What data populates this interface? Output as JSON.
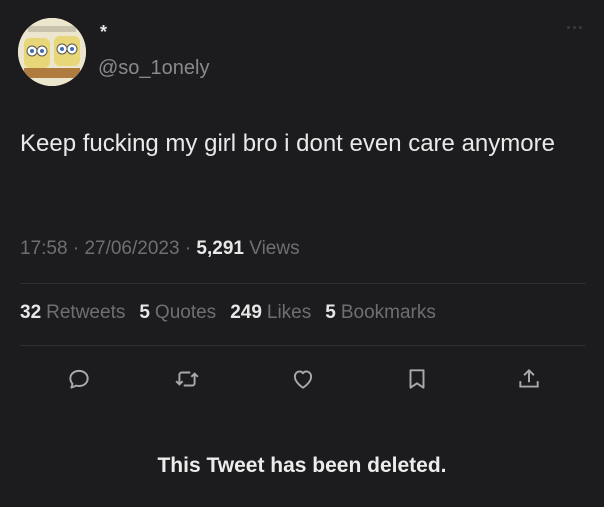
{
  "user": {
    "display_name": "*",
    "handle": "@so_1onely"
  },
  "tweet": {
    "text": "Keep fucking my girl bro i dont even care anymore",
    "time": "17:58",
    "date": "27/06/2023",
    "views_count": "5,291",
    "views_label": "Views"
  },
  "stats": {
    "retweets_count": "32",
    "retweets_label": "Retweets",
    "quotes_count": "5",
    "quotes_label": "Quotes",
    "likes_count": "249",
    "likes_label": "Likes",
    "bookmarks_count": "5",
    "bookmarks_label": "Bookmarks"
  },
  "icons": {
    "reply": "reply-icon",
    "retweet": "retweet-icon",
    "like": "heart-icon",
    "bookmark": "bookmark-icon",
    "share": "share-icon",
    "more": "more-icon"
  },
  "notice": {
    "deleted_text": "This Tweet has been deleted."
  },
  "colors": {
    "background": "#1c1c1e",
    "text_primary": "#e7e7e7",
    "text_secondary": "#6f6f73",
    "divider": "#2e2e31"
  }
}
